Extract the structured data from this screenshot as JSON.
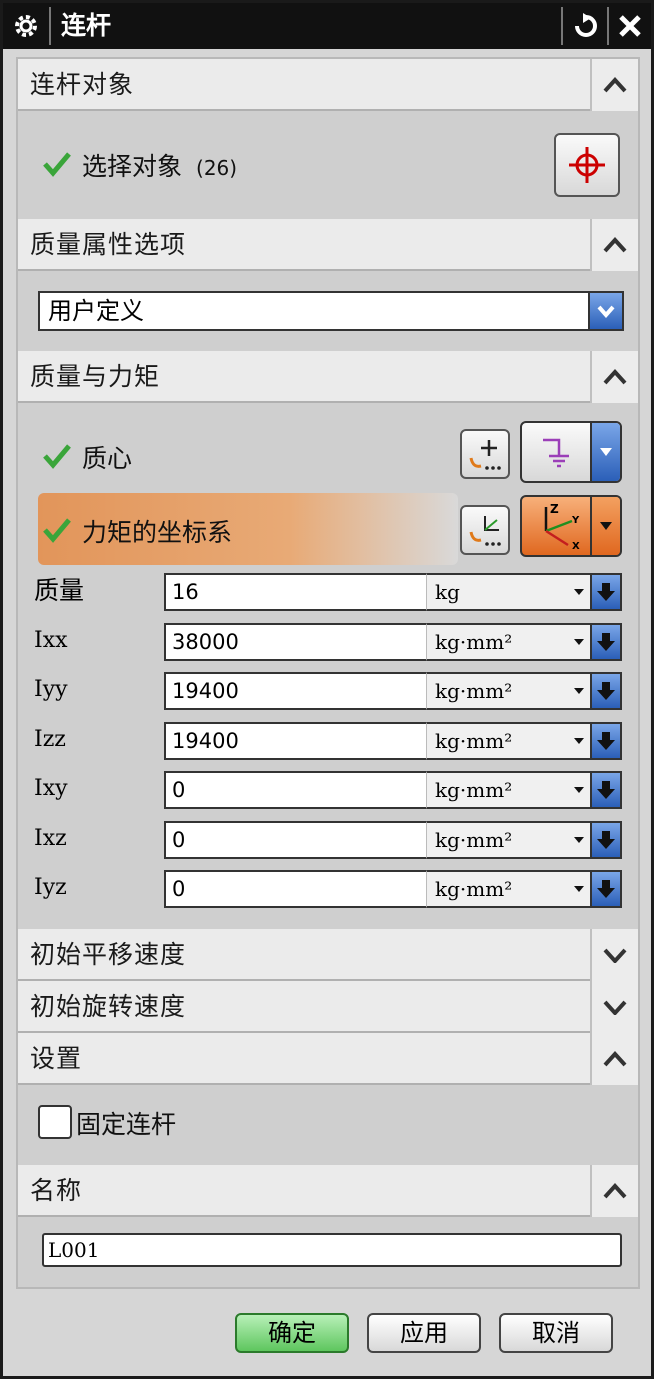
{
  "window": {
    "title": "连杆"
  },
  "sections": {
    "link_object": {
      "title": "连杆对象",
      "select_label": "选择对象",
      "select_count": "(26)"
    },
    "mass_option": {
      "title": "质量属性选项",
      "value": "用户定义"
    },
    "mass_moment": {
      "title": "质量与力矩",
      "centroid_label": "质心",
      "csys_label": "力矩的坐标系",
      "rows": [
        {
          "name": "质量",
          "value": "16",
          "unit": "kg"
        },
        {
          "name": "Ixx",
          "value": "38000",
          "unit": "kg·mm²"
        },
        {
          "name": "Iyy",
          "value": "19400",
          "unit": "kg·mm²"
        },
        {
          "name": "Izz",
          "value": "19400",
          "unit": "kg·mm²"
        },
        {
          "name": "Ixy",
          "value": "0",
          "unit": "kg·mm²"
        },
        {
          "name": "Ixz",
          "value": "0",
          "unit": "kg·mm²"
        },
        {
          "name": "Iyz",
          "value": "0",
          "unit": "kg·mm²"
        }
      ]
    },
    "init_translation": {
      "title": "初始平移速度"
    },
    "init_rotation": {
      "title": "初始旋转速度"
    },
    "settings": {
      "title": "设置",
      "fixed_label": "固定连杆",
      "fixed_checked": false
    },
    "name": {
      "title": "名称",
      "value": "L001"
    }
  },
  "buttons": {
    "ok": "确定",
    "apply": "应用",
    "cancel": "取消"
  },
  "colors": {
    "accent_blue": "#2b5fb8",
    "highlight_orange": "#e2955a",
    "check_green": "#3aa53a",
    "ok_green": "#5ec65e"
  }
}
